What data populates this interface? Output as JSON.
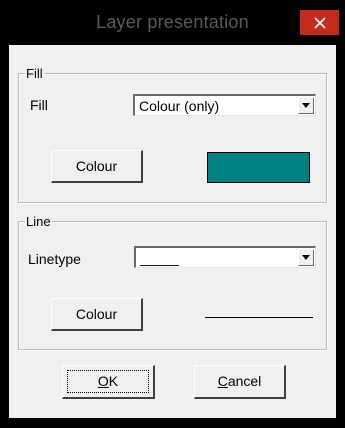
{
  "window": {
    "title": "Layer presentation"
  },
  "fill_group": {
    "legend": "Fill",
    "fill_label": "Fill",
    "fill_select_value": "Colour (only)",
    "colour_button": "Colour",
    "swatch_color": "#008080"
  },
  "line_group": {
    "legend": "Line",
    "linetype_label": "Linetype",
    "linetype_select_value": "_____",
    "colour_button": "Colour",
    "line_color": "#000000"
  },
  "buttons": {
    "ok": {
      "accel": "O",
      "rest": "K"
    },
    "cancel": {
      "accel": "C",
      "rest": "ancel"
    }
  },
  "icons": {
    "close": "close-icon",
    "dropdown": "chevron-down-icon"
  }
}
